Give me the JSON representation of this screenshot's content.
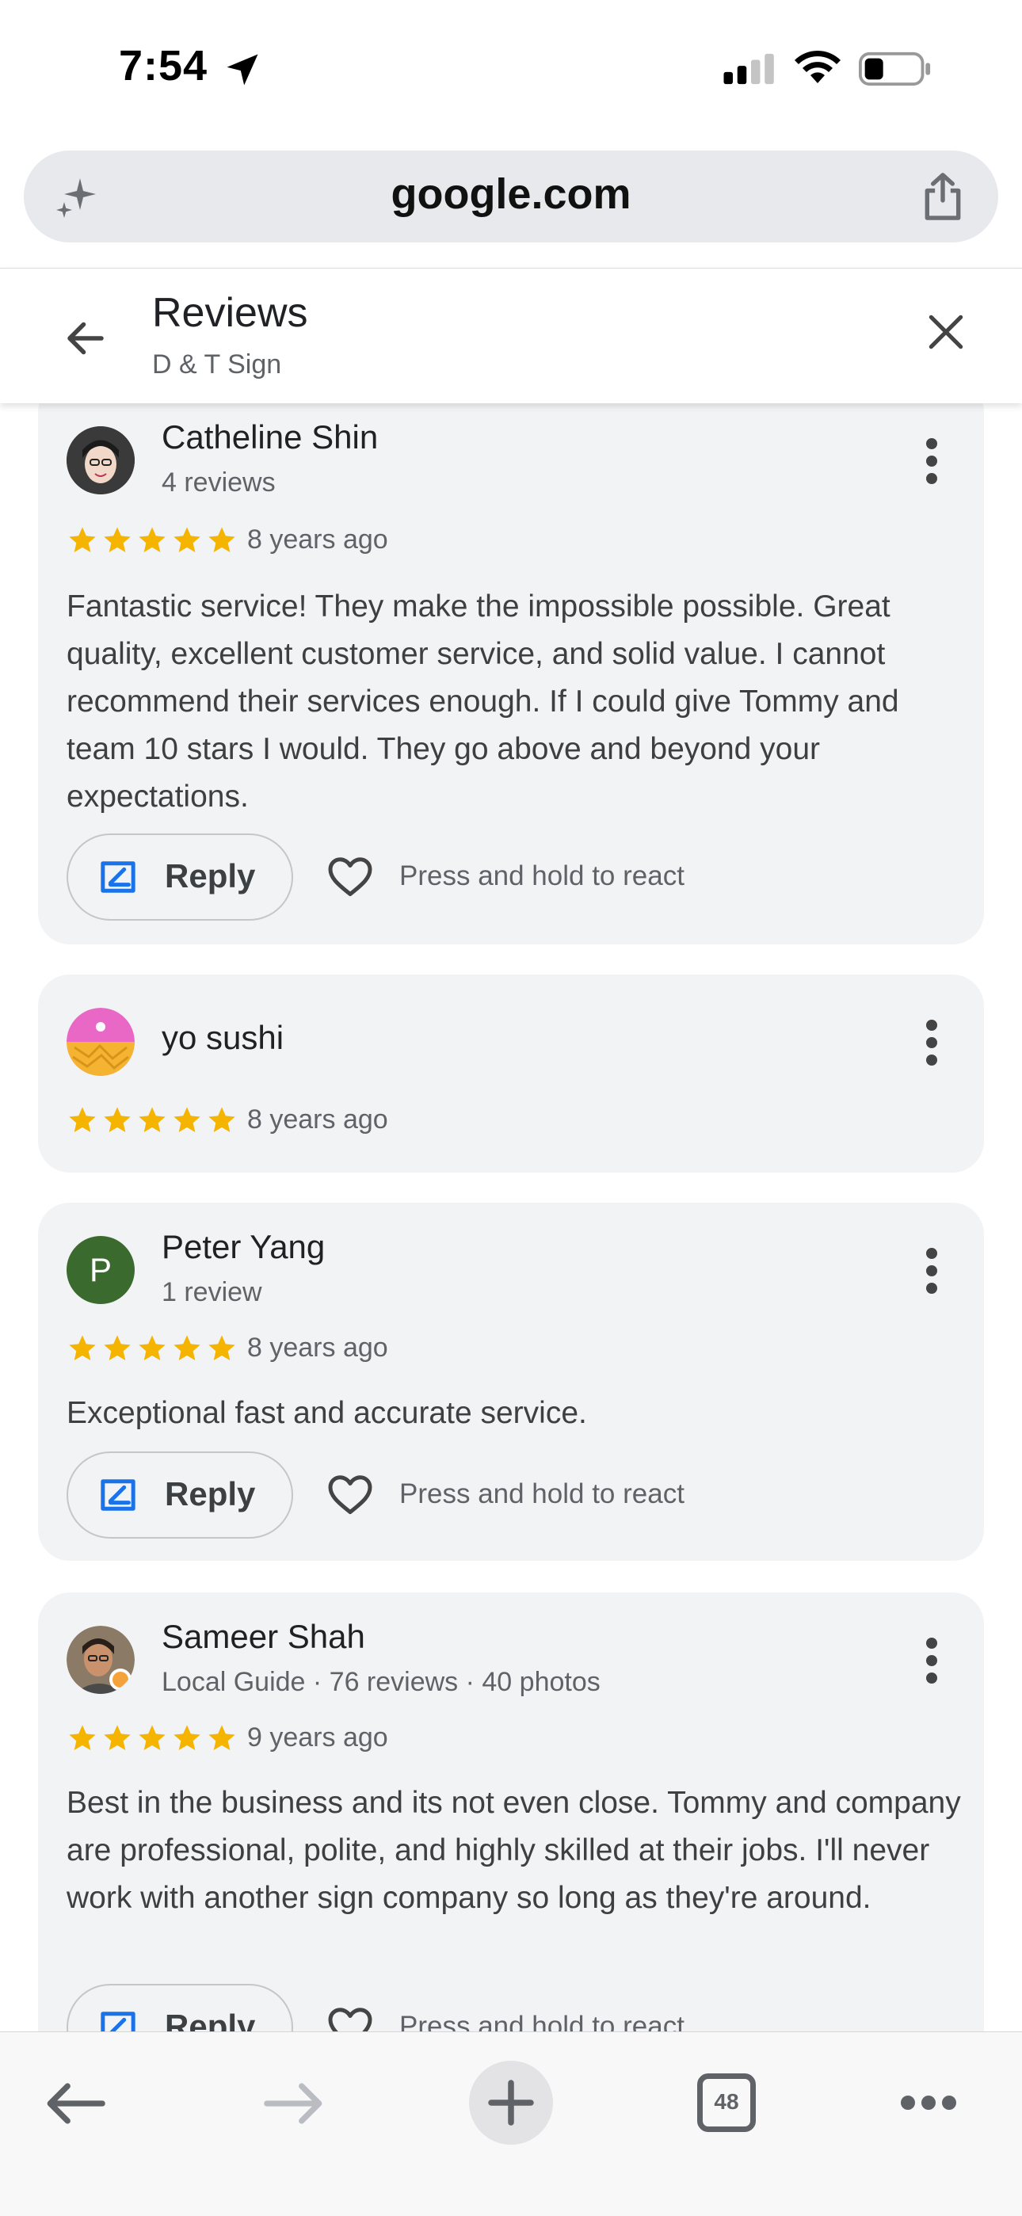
{
  "status_bar": {
    "time": "7:54"
  },
  "browser": {
    "url": "google.com",
    "tab_count": "48"
  },
  "header": {
    "title": "Reviews",
    "subtitle": "D & T Sign"
  },
  "reviews": [
    {
      "name": "Catheline Shin",
      "meta": "4 reviews",
      "rating": 5,
      "ago": "8 years ago",
      "text": "Fantastic service! They make the impossible possible. Great quality, excellent customer service, and solid value. I cannot recommend their services enough. If I could give Tommy and team 10 stars I would. They go above and beyond your expectations.",
      "reply_label": "Reply",
      "react_label": "Press and hold to react"
    },
    {
      "name": "yo sushi",
      "meta": "",
      "rating": 5,
      "ago": "8 years ago"
    },
    {
      "name": "Peter Yang",
      "initial": "P",
      "meta": "1 review",
      "rating": 5,
      "ago": "8 years ago",
      "text": "Exceptional fast and accurate service.",
      "reply_label": "Reply",
      "react_label": "Press and hold to react"
    },
    {
      "name": "Sameer Shah",
      "meta": "Local Guide · 76 reviews · 40 photos",
      "rating": 5,
      "ago": "9 years ago",
      "text": "Best in the business and its not even close. Tommy and company are professional, polite, and highly skilled at their jobs. I'll never work with another sign company so long as they're around.",
      "reply_label": "Reply",
      "react_label": "Press and hold to react"
    }
  ],
  "colors": {
    "star": "#f4b400",
    "reply_icon": "#1a73e8",
    "peter_avatar": "#3b6a2e"
  }
}
